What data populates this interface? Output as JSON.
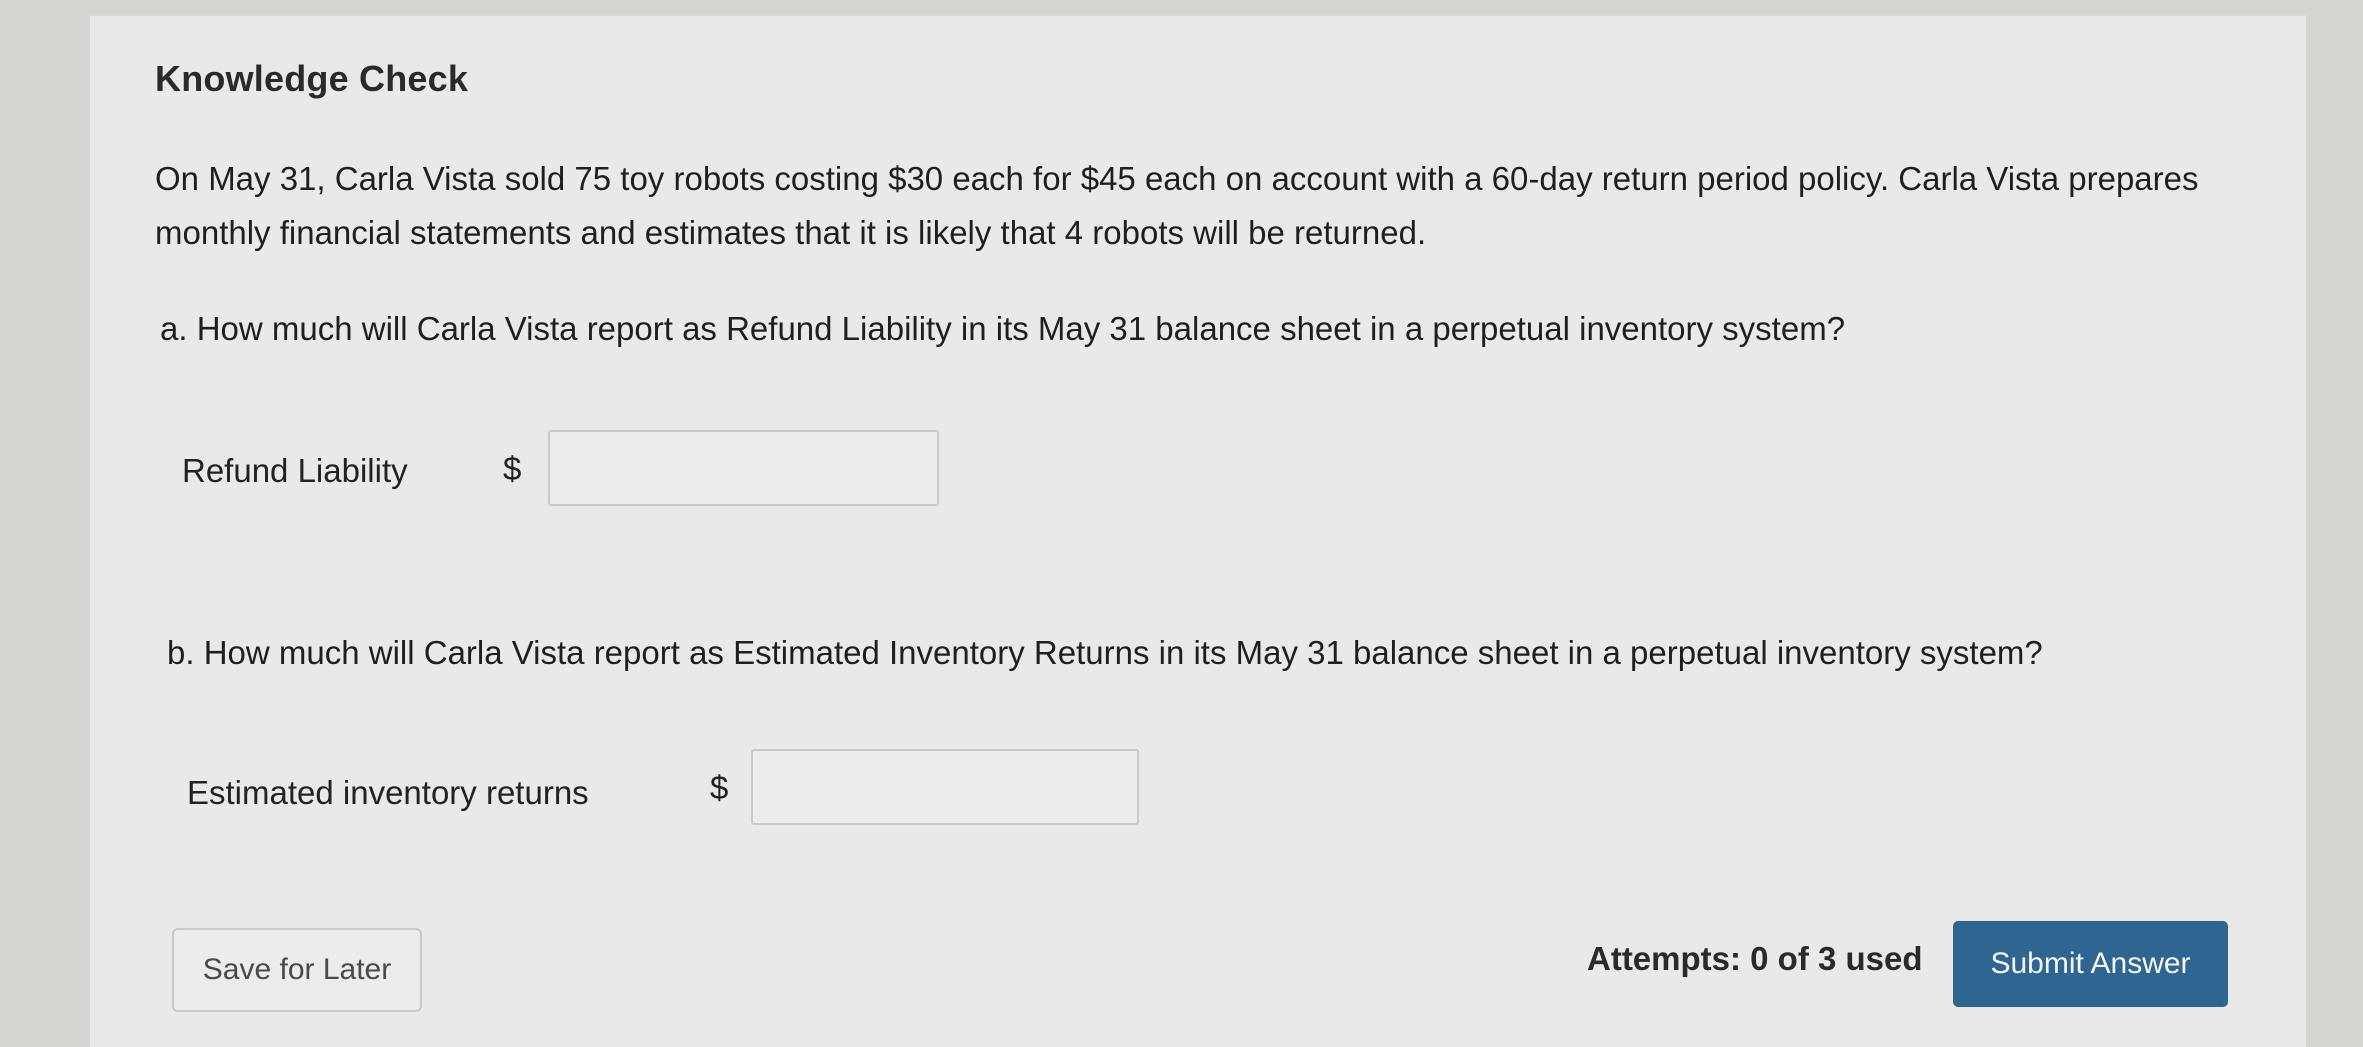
{
  "card": {
    "title": "Knowledge Check",
    "intro": "On May 31, Carla Vista sold 75 toy robots costing $30 each for $45 each on account with a 60-day return period policy. Carla Vista prepares monthly financial statements and estimates that it is likely that 4 robots will be returned."
  },
  "part_a": {
    "question": "a. How much will Carla Vista report as Refund Liability in its May 31 balance sheet in a perpetual inventory system?",
    "label": "Refund Liability",
    "currency": "$",
    "value": ""
  },
  "part_b": {
    "question": "b. How much will Carla Vista report as Estimated Inventory Returns in its May 31 balance sheet in a perpetual inventory system?",
    "label": "Estimated inventory returns",
    "currency": "$",
    "value": ""
  },
  "footer": {
    "save_label": "Save for Later",
    "attempts_text": "Attempts: 0 of 3 used",
    "submit_label": "Submit Answer"
  },
  "colors": {
    "submit_button": "#2f6591",
    "panel_background": "#e9e9e7"
  }
}
